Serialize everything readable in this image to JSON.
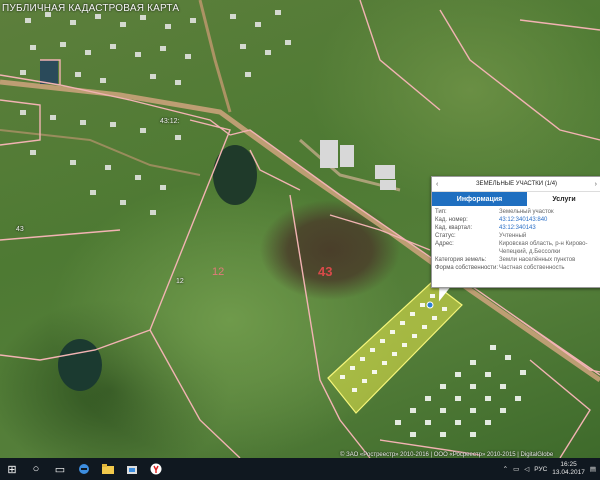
{
  "map": {
    "title": "ПУБЛИЧНАЯ КАДАСТРОВАЯ КАРТА",
    "parcel_labels": {
      "main": "43",
      "field_12": "12",
      "field_3": "3"
    },
    "small_labels": [
      "43",
      "12",
      "43:12:"
    ],
    "attribution": "© ЗАО «Ростреестр» 2010-2016 | ООО «Росреестр» 2010-2015 | DigitalGlobe"
  },
  "popup": {
    "title": "ЗЕМЕЛЬНЫЕ УЧАСТКИ (1/4)",
    "prev": "‹",
    "next": "›",
    "tabs": {
      "info": "Информация",
      "services": "Услуги"
    },
    "rows": [
      {
        "key": "Тип:",
        "value": "Земельный участок",
        "link": false
      },
      {
        "key": "Кад. номер:",
        "value": "43:12:340143:840",
        "link": true
      },
      {
        "key": "Кад. квартал:",
        "value": "43:12:340143",
        "link": true
      },
      {
        "key": "Статус:",
        "value": "Учтенный",
        "link": false
      },
      {
        "key": "Адрес:",
        "value": "Кировская область, р-н Кирово-Чепецкий, д.Бессолки",
        "link": false
      },
      {
        "key": "Категория земель:",
        "value": "Земли населённых пунктов",
        "link": false
      },
      {
        "key": "Форма собственности:",
        "value": "Частная собственность",
        "link": false
      }
    ]
  },
  "taskbar": {
    "start": "⊞",
    "search": "○",
    "task_view": "▭",
    "tray_lang": "РУС",
    "time": "16:25",
    "date": "13.04.2017"
  },
  "colors": {
    "boundary": "#f2b3b3",
    "road": "#c9a27a",
    "selected_parcel": "#e8e84a",
    "popup_tab": "#1f6fc0",
    "taskbar": "#101820"
  }
}
